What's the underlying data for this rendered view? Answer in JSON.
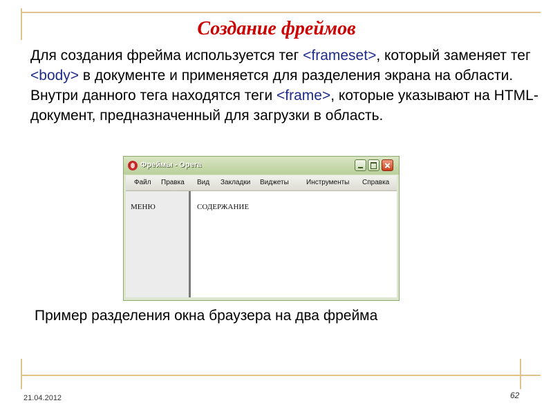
{
  "slide": {
    "title": "Создание фреймов",
    "paragraph": [
      {
        "text": "Для создания фрейма используется тег ",
        "tag": false
      },
      {
        "text": "<frameset>",
        "tag": true
      },
      {
        "text": ", который заменяет тег ",
        "tag": false
      },
      {
        "text": "<body>",
        "tag": true
      },
      {
        "text": " в документе и применяется для разделения экрана на области. Внутри данного тега находятся теги ",
        "tag": false
      },
      {
        "text": "<frame>",
        "tag": true
      },
      {
        "text": ", которые указывают на HTML-документ, предназначенный для загрузки в область.",
        "tag": false
      }
    ],
    "caption": "Пример разделения окна браузера на два фрейма",
    "date": "21.04.2012",
    "page_number": "62"
  },
  "browser": {
    "window_title": "Фреймы - Opera",
    "menu": [
      "Файл",
      "Правка",
      "Вид",
      "Закладки",
      "Виджеты",
      "Инструменты",
      "Справка"
    ],
    "left_frame_text": "МЕНЮ",
    "right_frame_text": "СОДЕРЖАНИЕ"
  },
  "colors": {
    "title": "#cc0000",
    "tag_text": "#1f2b8a",
    "decor_line": "#e0c38a"
  }
}
